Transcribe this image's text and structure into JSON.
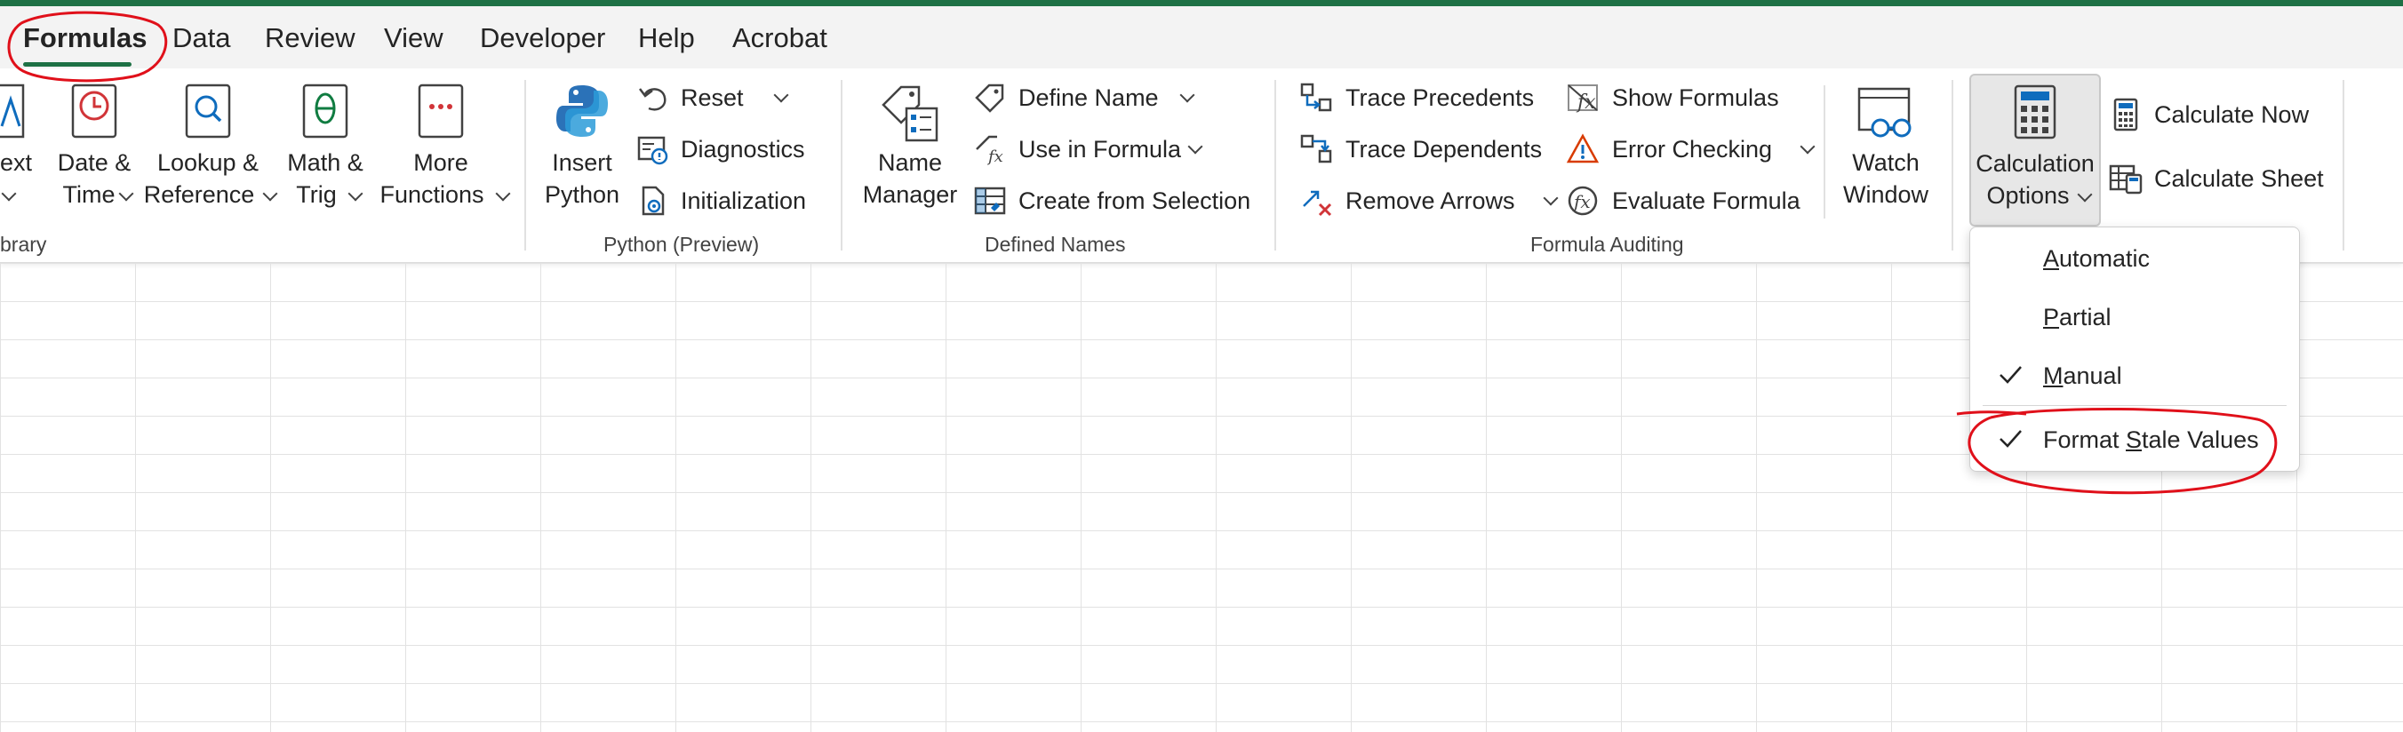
{
  "tabs": [
    {
      "label": "Formulas",
      "active": true
    },
    {
      "label": "Data"
    },
    {
      "label": "Review"
    },
    {
      "label": "View"
    },
    {
      "label": "Developer"
    },
    {
      "label": "Help"
    },
    {
      "label": "Acrobat"
    }
  ],
  "function_library": {
    "text_label": "ext",
    "date_time": [
      "Date &",
      "Time"
    ],
    "lookup": [
      "Lookup &",
      "Reference"
    ],
    "math": [
      "Math &",
      "Trig"
    ],
    "more": [
      "More",
      "Functions"
    ],
    "group": "brary"
  },
  "python": {
    "insert": [
      "Insert",
      "Python"
    ],
    "reset": "Reset",
    "diagnostics": "Diagnostics",
    "initialization": "Initialization",
    "group": "Python (Preview)"
  },
  "defined_names": {
    "name_manager": [
      "Name",
      "Manager"
    ],
    "define_name": "Define Name",
    "use_in_formula": "Use in Formula",
    "create_from_selection": "Create from Selection",
    "group": "Defined Names"
  },
  "formula_auditing": {
    "trace_precedents": "Trace Precedents",
    "trace_dependents": "Trace Dependents",
    "remove_arrows": "Remove Arrows",
    "show_formulas": "Show Formulas",
    "error_checking": "Error Checking",
    "evaluate_formula": "Evaluate Formula",
    "watch_window": [
      "Watch",
      "Window"
    ],
    "group": "Formula Auditing"
  },
  "calculation": {
    "options": [
      "Calculation",
      "Options"
    ],
    "calculate_now": "Calculate Now",
    "calculate_sheet": "Calculate Sheet"
  },
  "menu": {
    "automatic": {
      "pre": "",
      "key": "A",
      "post": "utomatic",
      "checked": false
    },
    "partial": {
      "pre": "",
      "key": "P",
      "post": "artial",
      "checked": false
    },
    "manual": {
      "pre": "",
      "key": "M",
      "post": "anual",
      "checked": true
    },
    "format_stale": {
      "pre": "Format ",
      "key": "S",
      "post": "tale Values",
      "checked": true
    }
  },
  "colors": {
    "accent": "#1e7145",
    "annotation": "#e0101a",
    "grid_line": "#e2e2e2"
  }
}
